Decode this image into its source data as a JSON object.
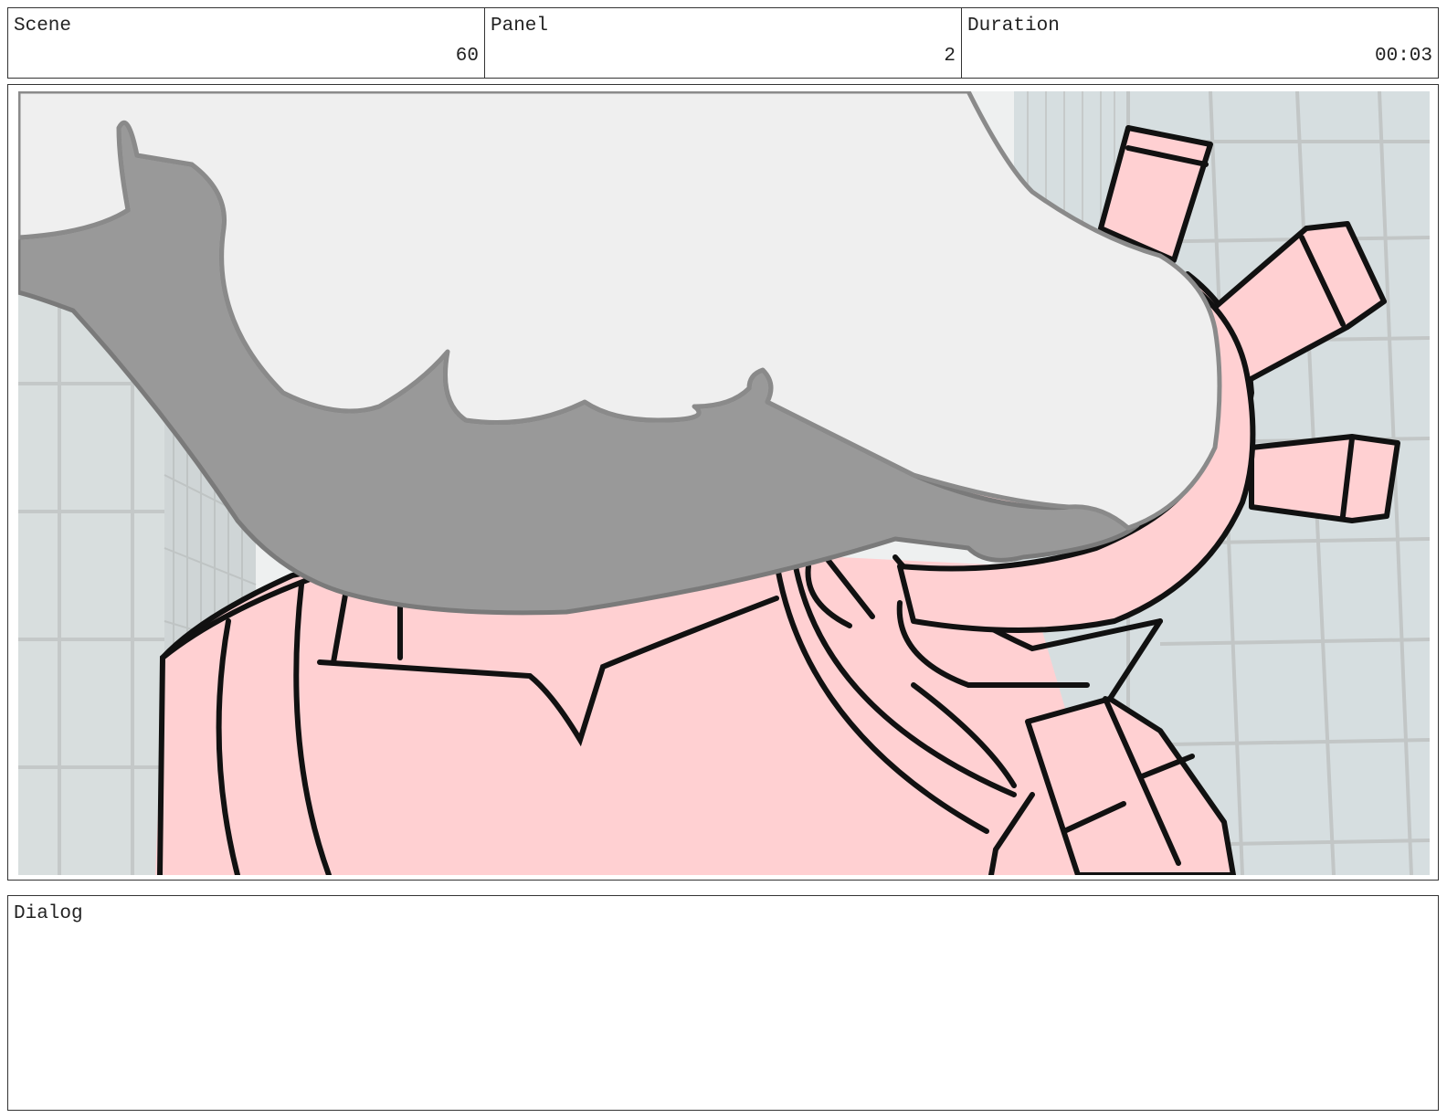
{
  "header": {
    "scene_label": "Scene",
    "scene_value": "60",
    "panel_label": "Panel",
    "panel_value": "2",
    "duration_label": "Duration",
    "duration_value": "00:03"
  },
  "dialog": {
    "label": "Dialog"
  },
  "colors": {
    "sky": "#eef0f0",
    "building_light": "#d5dddf",
    "building_frame": "#c8cccc",
    "building_glass": "#dfe6e8",
    "skin": "#ffd0d2",
    "cloud_light": "#efefef",
    "cloud_dark": "#999999",
    "outline": "#111111",
    "border": "#333333"
  }
}
